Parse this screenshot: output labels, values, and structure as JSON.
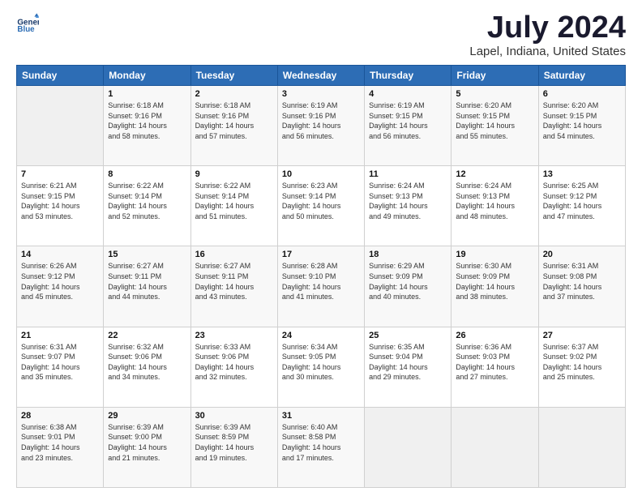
{
  "header": {
    "logo_line1": "General",
    "logo_line2": "Blue",
    "title": "July 2024",
    "subtitle": "Lapel, Indiana, United States"
  },
  "columns": [
    "Sunday",
    "Monday",
    "Tuesday",
    "Wednesday",
    "Thursday",
    "Friday",
    "Saturday"
  ],
  "weeks": [
    [
      {
        "day": "",
        "content": ""
      },
      {
        "day": "1",
        "content": "Sunrise: 6:18 AM\nSunset: 9:16 PM\nDaylight: 14 hours\nand 58 minutes."
      },
      {
        "day": "2",
        "content": "Sunrise: 6:18 AM\nSunset: 9:16 PM\nDaylight: 14 hours\nand 57 minutes."
      },
      {
        "day": "3",
        "content": "Sunrise: 6:19 AM\nSunset: 9:16 PM\nDaylight: 14 hours\nand 56 minutes."
      },
      {
        "day": "4",
        "content": "Sunrise: 6:19 AM\nSunset: 9:15 PM\nDaylight: 14 hours\nand 56 minutes."
      },
      {
        "day": "5",
        "content": "Sunrise: 6:20 AM\nSunset: 9:15 PM\nDaylight: 14 hours\nand 55 minutes."
      },
      {
        "day": "6",
        "content": "Sunrise: 6:20 AM\nSunset: 9:15 PM\nDaylight: 14 hours\nand 54 minutes."
      }
    ],
    [
      {
        "day": "7",
        "content": "Sunrise: 6:21 AM\nSunset: 9:15 PM\nDaylight: 14 hours\nand 53 minutes."
      },
      {
        "day": "8",
        "content": "Sunrise: 6:22 AM\nSunset: 9:14 PM\nDaylight: 14 hours\nand 52 minutes."
      },
      {
        "day": "9",
        "content": "Sunrise: 6:22 AM\nSunset: 9:14 PM\nDaylight: 14 hours\nand 51 minutes."
      },
      {
        "day": "10",
        "content": "Sunrise: 6:23 AM\nSunset: 9:14 PM\nDaylight: 14 hours\nand 50 minutes."
      },
      {
        "day": "11",
        "content": "Sunrise: 6:24 AM\nSunset: 9:13 PM\nDaylight: 14 hours\nand 49 minutes."
      },
      {
        "day": "12",
        "content": "Sunrise: 6:24 AM\nSunset: 9:13 PM\nDaylight: 14 hours\nand 48 minutes."
      },
      {
        "day": "13",
        "content": "Sunrise: 6:25 AM\nSunset: 9:12 PM\nDaylight: 14 hours\nand 47 minutes."
      }
    ],
    [
      {
        "day": "14",
        "content": "Sunrise: 6:26 AM\nSunset: 9:12 PM\nDaylight: 14 hours\nand 45 minutes."
      },
      {
        "day": "15",
        "content": "Sunrise: 6:27 AM\nSunset: 9:11 PM\nDaylight: 14 hours\nand 44 minutes."
      },
      {
        "day": "16",
        "content": "Sunrise: 6:27 AM\nSunset: 9:11 PM\nDaylight: 14 hours\nand 43 minutes."
      },
      {
        "day": "17",
        "content": "Sunrise: 6:28 AM\nSunset: 9:10 PM\nDaylight: 14 hours\nand 41 minutes."
      },
      {
        "day": "18",
        "content": "Sunrise: 6:29 AM\nSunset: 9:09 PM\nDaylight: 14 hours\nand 40 minutes."
      },
      {
        "day": "19",
        "content": "Sunrise: 6:30 AM\nSunset: 9:09 PM\nDaylight: 14 hours\nand 38 minutes."
      },
      {
        "day": "20",
        "content": "Sunrise: 6:31 AM\nSunset: 9:08 PM\nDaylight: 14 hours\nand 37 minutes."
      }
    ],
    [
      {
        "day": "21",
        "content": "Sunrise: 6:31 AM\nSunset: 9:07 PM\nDaylight: 14 hours\nand 35 minutes."
      },
      {
        "day": "22",
        "content": "Sunrise: 6:32 AM\nSunset: 9:06 PM\nDaylight: 14 hours\nand 34 minutes."
      },
      {
        "day": "23",
        "content": "Sunrise: 6:33 AM\nSunset: 9:06 PM\nDaylight: 14 hours\nand 32 minutes."
      },
      {
        "day": "24",
        "content": "Sunrise: 6:34 AM\nSunset: 9:05 PM\nDaylight: 14 hours\nand 30 minutes."
      },
      {
        "day": "25",
        "content": "Sunrise: 6:35 AM\nSunset: 9:04 PM\nDaylight: 14 hours\nand 29 minutes."
      },
      {
        "day": "26",
        "content": "Sunrise: 6:36 AM\nSunset: 9:03 PM\nDaylight: 14 hours\nand 27 minutes."
      },
      {
        "day": "27",
        "content": "Sunrise: 6:37 AM\nSunset: 9:02 PM\nDaylight: 14 hours\nand 25 minutes."
      }
    ],
    [
      {
        "day": "28",
        "content": "Sunrise: 6:38 AM\nSunset: 9:01 PM\nDaylight: 14 hours\nand 23 minutes."
      },
      {
        "day": "29",
        "content": "Sunrise: 6:39 AM\nSunset: 9:00 PM\nDaylight: 14 hours\nand 21 minutes."
      },
      {
        "day": "30",
        "content": "Sunrise: 6:39 AM\nSunset: 8:59 PM\nDaylight: 14 hours\nand 19 minutes."
      },
      {
        "day": "31",
        "content": "Sunrise: 6:40 AM\nSunset: 8:58 PM\nDaylight: 14 hours\nand 17 minutes."
      },
      {
        "day": "",
        "content": ""
      },
      {
        "day": "",
        "content": ""
      },
      {
        "day": "",
        "content": ""
      }
    ]
  ]
}
